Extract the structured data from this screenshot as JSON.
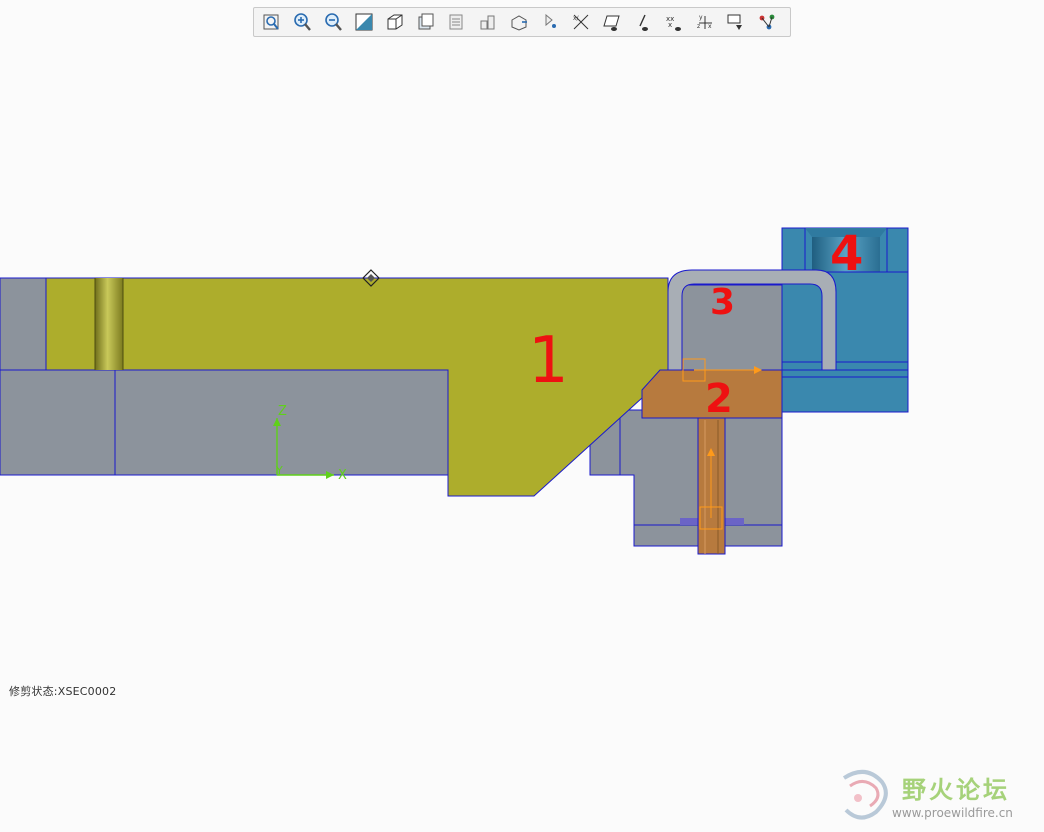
{
  "toolbar": {
    "buttons": [
      {
        "name": "zoom-fit-button",
        "icon": "zoom-fit-icon"
      },
      {
        "name": "zoom-in-button",
        "icon": "zoom-in-icon"
      },
      {
        "name": "zoom-out-button",
        "icon": "zoom-out-icon"
      },
      {
        "name": "repaint-button",
        "icon": "repaint-icon"
      },
      {
        "name": "display-style-button",
        "icon": "display-style-icon"
      },
      {
        "name": "saved-views-button",
        "icon": "saved-views-icon"
      },
      {
        "name": "layers-button",
        "icon": "layers-icon"
      },
      {
        "name": "view-manager-button",
        "icon": "view-manager-icon"
      },
      {
        "name": "perspective-button",
        "icon": "perspective-icon"
      },
      {
        "name": "spin-center-button",
        "icon": "spin-center-icon"
      },
      {
        "name": "annotation-display-button",
        "icon": "annotation-display-icon"
      },
      {
        "name": "datum-plane-display-button",
        "icon": "datum-plane-icon"
      },
      {
        "name": "datum-axis-display-button",
        "icon": "datum-axis-icon"
      },
      {
        "name": "datum-point-display-button",
        "icon": "datum-point-icon"
      },
      {
        "name": "csys-display-button",
        "icon": "csys-icon"
      },
      {
        "name": "selection-filter-button",
        "icon": "selection-filter-icon"
      },
      {
        "name": "model-tree-button",
        "icon": "model-tree-icon"
      }
    ]
  },
  "annotations": {
    "label_1": "1",
    "label_2": "2",
    "label_3": "3",
    "label_4": "4"
  },
  "csys": {
    "x_label": "X",
    "y_label": "Y",
    "z_label": "Z"
  },
  "status": {
    "text": "修剪状态:XSEC0002"
  },
  "watermark": {
    "title": "野火论坛",
    "url": "www.proewildfire.cn"
  },
  "colors": {
    "part_gray": "#8c939c",
    "part_olive": "#adad2c",
    "part_orange": "#b77a3e",
    "part_blue": "#3a88ae",
    "edge_blue": "#1a1acc",
    "annotation_red": "#ee1111",
    "csys_green": "#5fd01a"
  }
}
